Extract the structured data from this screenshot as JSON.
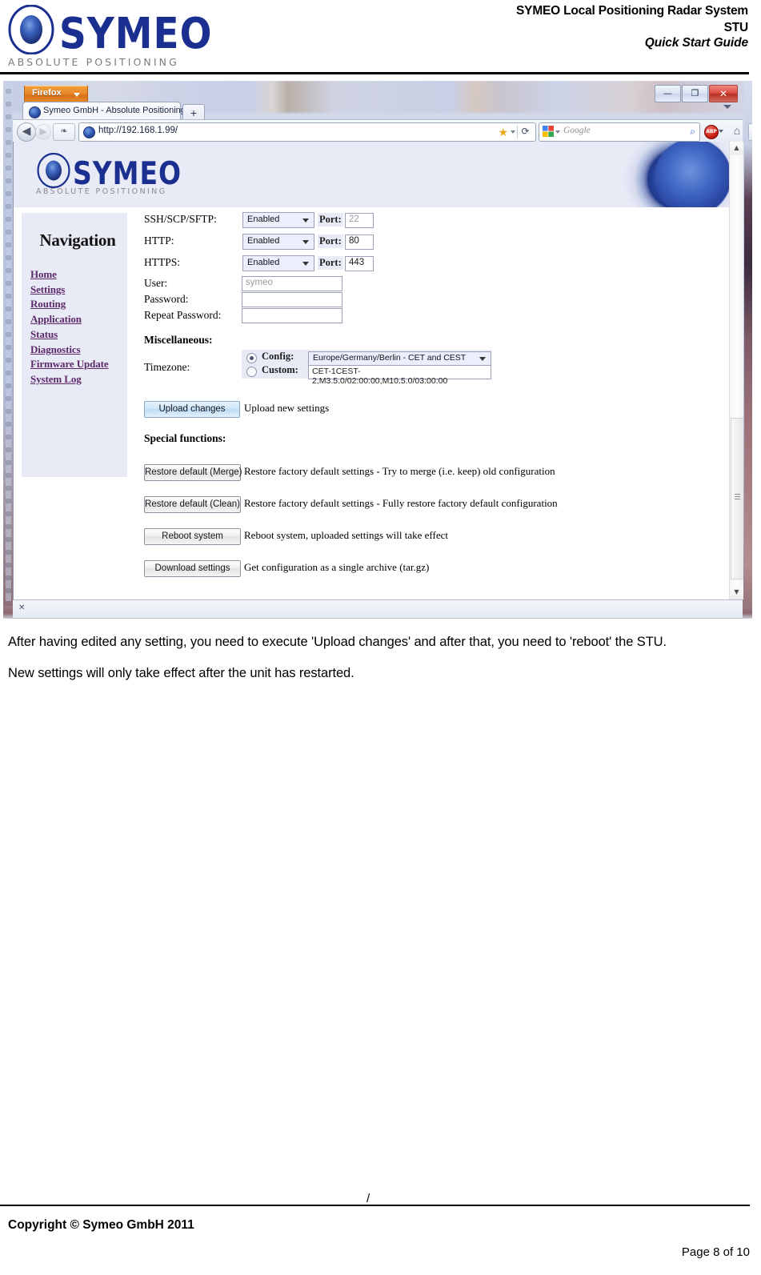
{
  "document": {
    "brand_word": "SYMEO",
    "brand_tagline": "ABSOLUTE POSITIONING",
    "title_line1": "SYMEO Local Positioning Radar System",
    "title_line2": "STU",
    "subtitle": "Quick Start Guide",
    "footer_slash": "/",
    "footer_copyright": "Copyright © Symeo GmbH 2011",
    "footer_page": "Page 8 of 10"
  },
  "body": {
    "paragraphs": [
      "After having edited any setting, you need to execute 'Upload changes' and after that, you need to 'reboot' the STU.",
      "New settings will only take effect after the unit has restarted."
    ]
  },
  "browser": {
    "app_menu_label": "Firefox",
    "tab": {
      "title": "Symeo GmbH - Absolute Positioning",
      "new_tab_label": "+"
    },
    "window_controls": {
      "minimize": "—",
      "maximize": "❐",
      "close": "✕"
    },
    "toolbar": {
      "back_glyph": "◀",
      "forward_glyph": "▶",
      "site_glyph": "❧",
      "url": "http://192.168.1.99/",
      "reload_glyph": "⟳",
      "star_glyph": "★",
      "search_placeholder": "Google",
      "search_go_glyph": "⌕",
      "adblock_label": "ABP",
      "home_glyph": "⌂",
      "extra_glyph": "✦"
    },
    "findbar": {
      "close_glyph": "✕"
    },
    "scrollbar": {
      "up_glyph": "▲",
      "down_glyph": "▼"
    }
  },
  "webpage": {
    "banner": {
      "brand_word": "SYMEO",
      "brand_tagline": "ABSOLUTE POSITIONING"
    },
    "navigation": {
      "title": "Navigation",
      "links": [
        "Home",
        "Settings",
        "Routing",
        "Application",
        "Status",
        "Diagnostics",
        "Firmware Update",
        "System Log"
      ]
    },
    "services": [
      {
        "label": "SSH/SCP/SFTP:",
        "state": "Enabled",
        "port_label": "Port:",
        "port": "22"
      },
      {
        "label": "HTTP:",
        "state": "Enabled",
        "port_label": "Port:",
        "port": "80"
      },
      {
        "label": "HTTPS:",
        "state": "Enabled",
        "port_label": "Port:",
        "port": "443"
      }
    ],
    "credentials": [
      {
        "label": "User:",
        "value": "symeo"
      },
      {
        "label": "Password:",
        "value": ""
      },
      {
        "label": "Repeat Password:",
        "value": ""
      }
    ],
    "miscellaneous": {
      "heading": "Miscellaneous:",
      "timezone_label": "Timezone:",
      "config_key": "Config:",
      "config_value": "Europe/Germany/Berlin - CET and CEST",
      "custom_key": "Custom:",
      "custom_value": "CET-1CEST-2,M3.5.0/02:00:00,M10.5.0/03:00:00",
      "selected_mode": "config"
    },
    "upload": {
      "button": "Upload changes",
      "description": "Upload new settings"
    },
    "special_functions": {
      "heading": "Special functions:",
      "items": [
        {
          "button": "Restore default (Merge)",
          "description": "Restore factory default settings - Try to merge (i.e. keep) old configuration"
        },
        {
          "button": "Restore default (Clean)",
          "description": "Restore factory default settings - Fully restore factory default configuration"
        },
        {
          "button": "Reboot system",
          "description": "Reboot system, uploaded settings will take effect"
        },
        {
          "button": "Download settings",
          "description": "Get configuration as a single archive (tar.gz)"
        }
      ]
    }
  },
  "colors": {
    "brand_blue": "#1a2f8f",
    "panel_lavender": "#e8eaf6",
    "link_purple": "#5c2a6b",
    "firefox_orange": "#e8872a"
  }
}
